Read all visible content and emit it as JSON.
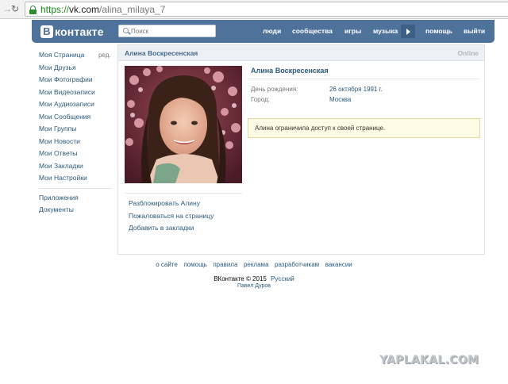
{
  "browser": {
    "url_scheme": "https://",
    "url_host": "vk.com",
    "url_path": "/alina_milaya_7"
  },
  "header": {
    "logo_letter": "В",
    "logo_text": "контакте",
    "search_placeholder": "Поиск",
    "nav": [
      {
        "label": "люди"
      },
      {
        "label": "сообщества"
      },
      {
        "label": "игры"
      },
      {
        "label": "музыка"
      },
      {
        "label": "помощь"
      },
      {
        "label": "выйти"
      }
    ]
  },
  "sidebar": {
    "edit_label": "ред.",
    "items": [
      {
        "label": "Моя Страница"
      },
      {
        "label": "Мои Друзья"
      },
      {
        "label": "Мои Фотографии"
      },
      {
        "label": "Мои Видеозаписи"
      },
      {
        "label": "Мои Аудиозаписи"
      },
      {
        "label": "Мои Сообщения"
      },
      {
        "label": "Мои Группы"
      },
      {
        "label": "Мои Новости"
      },
      {
        "label": "Мои Ответы"
      },
      {
        "label": "Мои Закладки"
      },
      {
        "label": "Мои Настройки"
      }
    ],
    "extra_items": [
      {
        "label": "Приложения"
      },
      {
        "label": "Документы"
      }
    ]
  },
  "profile": {
    "header_name": "Алина Воскресенская",
    "status": "Online",
    "full_name": "Алина Воскресенская",
    "info": [
      {
        "label": "День рождения:",
        "value": "26 октября 1991 г."
      },
      {
        "label": "Город:",
        "value": "Москва"
      }
    ],
    "notice": "Алина ограничила доступ к своей странице.",
    "actions": [
      {
        "label": "Разблокировать Алину"
      },
      {
        "label": "Пожаловаться на страницу"
      },
      {
        "label": "Добавить в закладки"
      }
    ]
  },
  "footer": {
    "links": [
      {
        "label": "о сайте"
      },
      {
        "label": "помощь"
      },
      {
        "label": "правила"
      },
      {
        "label": "реклама"
      },
      {
        "label": "разработчикам"
      },
      {
        "label": "вакансии"
      }
    ],
    "copyright": "ВКонтакте © 2015",
    "language": "Русский",
    "author": "Павел Дуров"
  },
  "watermark": "YAPLAKAL.COM",
  "colors": {
    "header_bg": "#4e729a",
    "link": "#2b587a",
    "notice_bg": "#fefbe5"
  }
}
